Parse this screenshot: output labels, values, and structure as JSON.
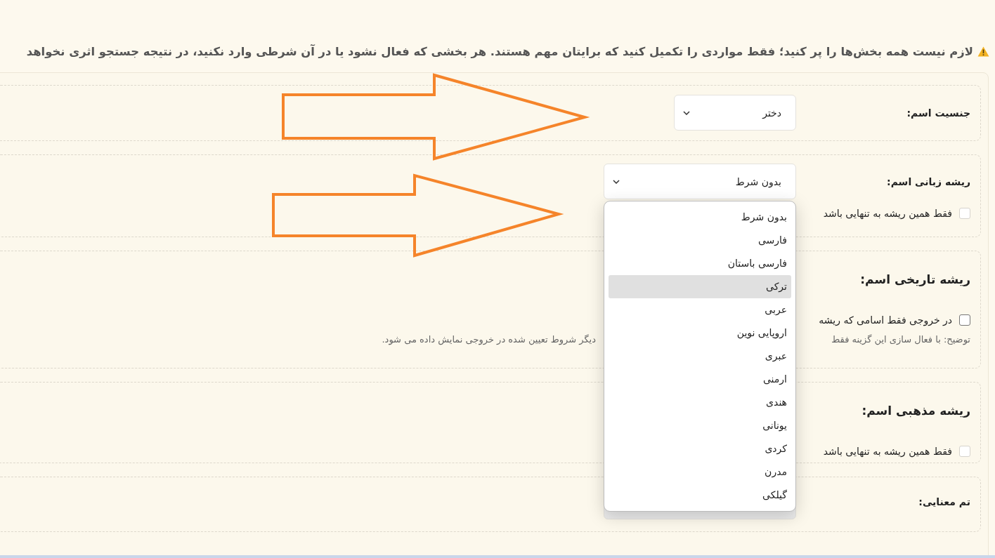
{
  "notice": {
    "text": "لازم نیست همه بخش‌ها را پر کنید؛ فقط مواردی را تکمیل کنید که برایتان مهم هستند. هر بخشی که فعال نشود یا در آن شرطی وارد نکنید، در نتیجه جستجو اثری نخواهد"
  },
  "sections": [
    {
      "kind": "select",
      "label": "جنسیت اسم:",
      "select": {
        "value": "دختر"
      }
    },
    {
      "kind": "select",
      "label": "ریشه زبانی اسم:",
      "select": {
        "value": "بدون شرط",
        "open": true,
        "options": [
          {
            "label": "بدون شرط",
            "highlighted": false
          },
          {
            "label": "فارسی",
            "highlighted": false
          },
          {
            "label": "فارسی باستان",
            "highlighted": false
          },
          {
            "label": "ترکی",
            "highlighted": true
          },
          {
            "label": "عربی",
            "highlighted": false
          },
          {
            "label": "اروپایی نوین",
            "highlighted": false
          },
          {
            "label": "عبری",
            "highlighted": false
          },
          {
            "label": "ارمنی",
            "highlighted": false
          },
          {
            "label": "هندی",
            "highlighted": false
          },
          {
            "label": "یونانی",
            "highlighted": false
          },
          {
            "label": "کردی",
            "highlighted": false
          },
          {
            "label": "مدرن",
            "highlighted": false
          },
          {
            "label": "گیلکی",
            "highlighted": false
          }
        ]
      },
      "checkbox": {
        "label": "فقط همین ریشه به تنهایی باشد",
        "checked": false
      }
    },
    {
      "kind": "heading",
      "label": "ریشه تاریخی اسم:",
      "checkbox": {
        "label": "در خروجی فقط اسامی که ریشه",
        "checked": false
      },
      "note": [
        "توضیح: با فعال سازی این گزینه فقط",
        "دیگر شروط تعیین شده در خروجی نمایش داده می شود."
      ]
    },
    {
      "kind": "heading",
      "label": "ریشه مذهبی اسم:",
      "checkbox": {
        "label": "فقط همین ریشه به تنهایی باشد",
        "checked": false
      }
    },
    {
      "kind": "select",
      "label": "تم معنایی:"
    }
  ],
  "annotations": [
    {
      "kind": "arrow"
    },
    {
      "kind": "arrow"
    }
  ]
}
